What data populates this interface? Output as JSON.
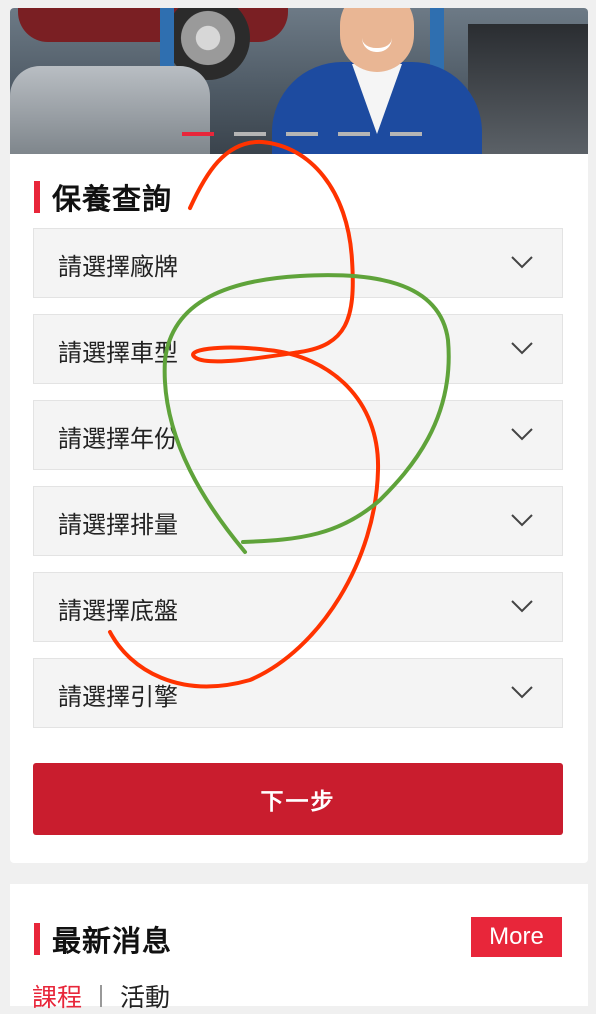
{
  "banner": {
    "carousel": {
      "slide_count": 5,
      "active_index": 0
    }
  },
  "maintenance": {
    "title": "保養查詢",
    "selects": [
      {
        "label": "請選擇廠牌",
        "icon": "chevron-down-icon"
      },
      {
        "label": "請選擇車型",
        "icon": "chevron-down-icon"
      },
      {
        "label": "請選擇年份",
        "icon": "chevron-down-icon"
      },
      {
        "label": "請選擇排量",
        "icon": "chevron-down-icon"
      },
      {
        "label": "請選擇底盤",
        "icon": "chevron-down-icon"
      },
      {
        "label": "請選擇引擎",
        "icon": "chevron-down-icon"
      }
    ],
    "next_label": "下一步"
  },
  "news": {
    "title": "最新消息",
    "more_label": "More",
    "tabs": [
      {
        "label": "課程",
        "active": true
      },
      {
        "label": "活動",
        "active": false
      }
    ]
  },
  "colors": {
    "accent": "#e8263a",
    "button": "#c91d2e",
    "annotation_red": "#ff3300",
    "annotation_green": "#5fa33a"
  }
}
